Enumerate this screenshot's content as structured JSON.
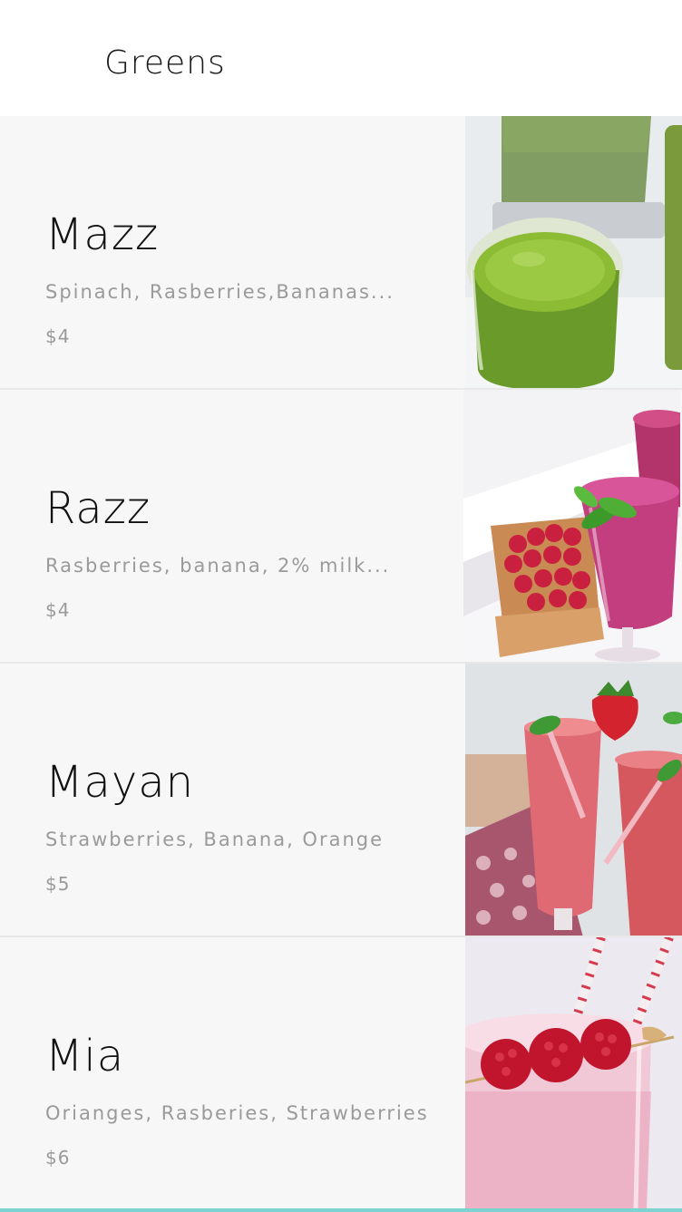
{
  "header": {
    "title": "Greens"
  },
  "items": [
    {
      "name": "Mazz",
      "description": "Spinach, Rasberries,Bananas...",
      "price": "$4",
      "image": "green-smoothie-photo"
    },
    {
      "name": "Razz",
      "description": "Rasberries, banana, 2% milk...",
      "price": "$4",
      "image": "berry-smoothie-photo"
    },
    {
      "name": "Mayan",
      "description": "Strawberries, Banana, Orange",
      "price": "$5",
      "image": "strawberry-smoothie-photo"
    },
    {
      "name": "Mia",
      "description": "Orianges, Rasberies, Strawberries",
      "price": "$6",
      "image": "pink-smoothie-photo"
    }
  ],
  "colors": {
    "row_background": "#f7f7f7",
    "divider": "#e8e8e8",
    "accent_bar": "#7dd3cf",
    "secondary_text": "#9a9a9a"
  }
}
